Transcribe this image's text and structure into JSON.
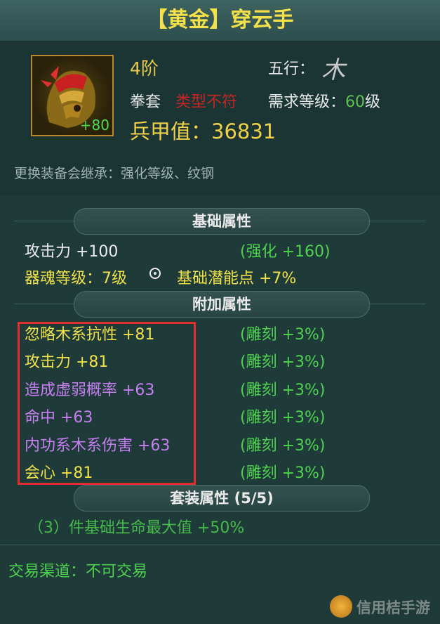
{
  "title": "【黄金】穿云手",
  "item": {
    "plus": "+80",
    "tier": "4阶",
    "element_label": "五行：",
    "element_glyph": "木",
    "type": "拳套",
    "type_mismatch": "类型不符",
    "req_label": "需求等级：",
    "req_level": "60",
    "req_unit": "级",
    "armor_value": "兵甲值：36831",
    "inherit_note": "更换装备会继承：强化等级、纹钢"
  },
  "basic": {
    "header": "基础属性",
    "attack": "攻击力  +100",
    "attack_enhance": "(强化 +160)",
    "soul_level": "器魂等级：7级",
    "potential": "基础潜能点  +7%"
  },
  "extra": {
    "header": "附加属性",
    "rows": [
      {
        "label": "忽略木系抗性  +81",
        "note": "(雕刻 +3%)"
      },
      {
        "label": "攻击力  +81",
        "note": "(雕刻 +3%)"
      },
      {
        "label": "造成虚弱概率  +63",
        "note": "(雕刻 +3%)"
      },
      {
        "label": "命中  +63",
        "note": "(雕刻 +3%)"
      },
      {
        "label": "内功系木系伤害  +63",
        "note": "(雕刻 +3%)"
      },
      {
        "label": "会心  +81",
        "note": "(雕刻 +3%)"
      }
    ]
  },
  "set": {
    "header": "套装属性 (5/5)",
    "bonus": "（3）件基础生命最大值  +50%"
  },
  "trade": "交易渠道：不可交易",
  "watermark": "信用桔手游",
  "colors": {
    "gold": "#f4e04a",
    "green": "#4fd14f",
    "purple": "#c77ef0",
    "red": "#c42626",
    "highlight": "#e02e2e"
  }
}
